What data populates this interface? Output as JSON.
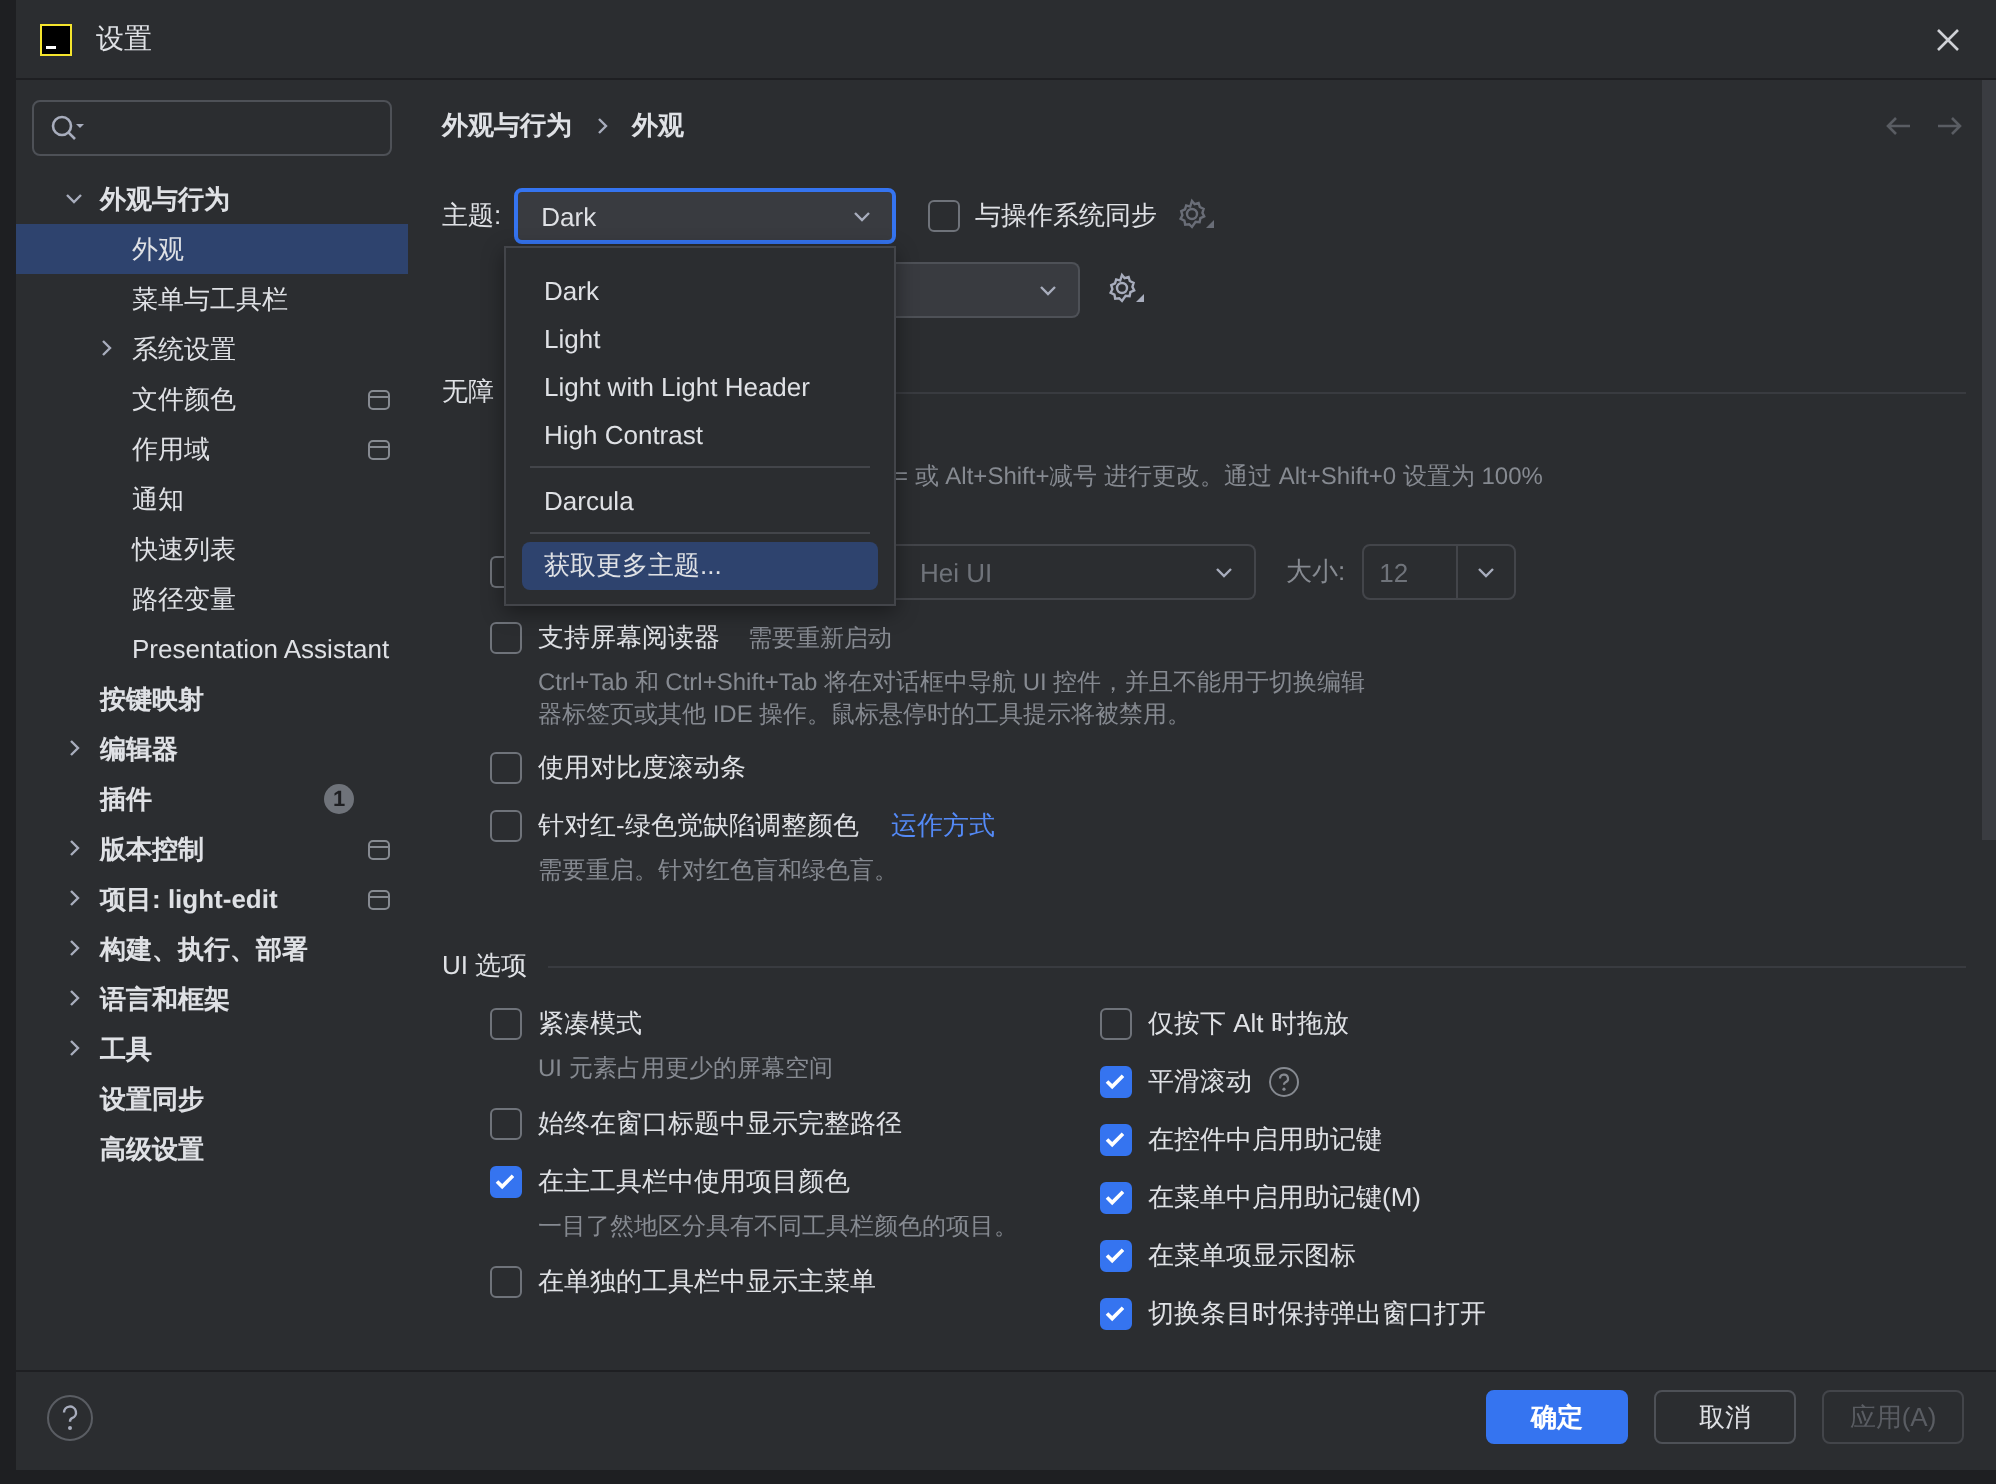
{
  "window": {
    "title": "设置"
  },
  "sidebar": {
    "items": [
      {
        "label": "外观与行为",
        "kind": "group",
        "expanded": true,
        "selected": false,
        "scoped": false,
        "children": [
          {
            "label": "外观",
            "kind": "leaf",
            "selected": true,
            "scoped": false
          },
          {
            "label": "菜单与工具栏",
            "kind": "leaf",
            "selected": false,
            "scoped": false
          },
          {
            "label": "系统设置",
            "kind": "group",
            "expanded": false,
            "selected": false,
            "scoped": false
          },
          {
            "label": "文件颜色",
            "kind": "leaf",
            "selected": false,
            "scoped": true
          },
          {
            "label": "作用域",
            "kind": "leaf",
            "selected": false,
            "scoped": true
          },
          {
            "label": "通知",
            "kind": "leaf",
            "selected": false,
            "scoped": false
          },
          {
            "label": "快速列表",
            "kind": "leaf",
            "selected": false,
            "scoped": false
          },
          {
            "label": "路径变量",
            "kind": "leaf",
            "selected": false,
            "scoped": false
          },
          {
            "label": "Presentation Assistant",
            "kind": "leaf",
            "selected": false,
            "scoped": false
          }
        ]
      },
      {
        "label": "按键映射",
        "kind": "leaf",
        "selected": false,
        "scoped": false
      },
      {
        "label": "编辑器",
        "kind": "group",
        "expanded": false,
        "selected": false,
        "scoped": false
      },
      {
        "label": "插件",
        "kind": "leaf",
        "selected": false,
        "scoped": false,
        "badge": "1"
      },
      {
        "label": "版本控制",
        "kind": "group",
        "expanded": false,
        "selected": false,
        "scoped": true
      },
      {
        "label": "项目: light-edit",
        "kind": "group",
        "expanded": false,
        "selected": false,
        "scoped": true
      },
      {
        "label": "构建、执行、部署",
        "kind": "group",
        "expanded": false,
        "selected": false,
        "scoped": false
      },
      {
        "label": "语言和框架",
        "kind": "group",
        "expanded": false,
        "selected": false,
        "scoped": false
      },
      {
        "label": "工具",
        "kind": "group",
        "expanded": false,
        "selected": false,
        "scoped": false
      },
      {
        "label": "设置同步",
        "kind": "leaf",
        "selected": false,
        "scoped": false
      },
      {
        "label": "高级设置",
        "kind": "leaf",
        "selected": false,
        "scoped": false
      }
    ]
  },
  "content": {
    "breadcrumb": [
      "外观与行为",
      "外观"
    ],
    "theme": {
      "label": "主题:",
      "value": "Dark",
      "menu": [
        {
          "kind": "option",
          "label": "Dark",
          "highlighted": false
        },
        {
          "kind": "option",
          "label": "Light",
          "highlighted": false
        },
        {
          "kind": "option",
          "label": "Light with Light Header",
          "highlighted": false
        },
        {
          "kind": "option",
          "label": "High Contrast",
          "highlighted": false
        },
        {
          "kind": "separator"
        },
        {
          "kind": "option",
          "label": "Darcula",
          "highlighted": false
        },
        {
          "kind": "separator"
        },
        {
          "kind": "option",
          "label": "获取更多主题...",
          "highlighted": true
        }
      ]
    },
    "sync_with_os": {
      "label": "与操作系统同步",
      "checked": false
    },
    "accessibility": {
      "title": "无障",
      "zoom_hint": "= 或 Alt+Shift+减号 进行更改。通过 Alt+Shift+0 设置为 100%",
      "font": {
        "checked": false,
        "value": "Hei UI",
        "size_label": "大小:",
        "size": "12"
      },
      "options": [
        {
          "label": "支持屏幕阅读器",
          "checked": false,
          "note": "需要重新启动",
          "description": "Ctrl+Tab 和 Ctrl+Shift+Tab 将在对话框中导航 UI 控件，并且不能用于切换编辑器标签页或其他 IDE 操作。鼠标悬停时的工具提示将被禁用。"
        },
        {
          "label": "使用对比度滚动条",
          "checked": false
        },
        {
          "label": "针对红-绿色觉缺陷调整颜色",
          "checked": false,
          "link": "运作方式",
          "description": "需要重启。针对红色盲和绿色盲。"
        }
      ]
    },
    "ui_options": {
      "title": "UI 选项",
      "left": [
        {
          "label": "紧凑模式",
          "checked": false,
          "description": "UI 元素占用更少的屏幕空间"
        },
        {
          "label": "始终在窗口标题中显示完整路径",
          "checked": false
        },
        {
          "label": "在主工具栏中使用项目颜色",
          "checked": true,
          "description": "一目了然地区分具有不同工具栏颜色的项目。"
        },
        {
          "label": "在单独的工具栏中显示主菜单",
          "checked": false
        }
      ],
      "right": [
        {
          "label": "仅按下 Alt 时拖放",
          "checked": false
        },
        {
          "label": "平滑滚动",
          "checked": true,
          "help": true
        },
        {
          "label": "在控件中启用助记键",
          "checked": true
        },
        {
          "label": "在菜单中启用助记键(M)",
          "checked": true
        },
        {
          "label": "在菜单项显示图标",
          "checked": true
        },
        {
          "label": "切换条目时保持弹出窗口打开",
          "checked": true
        }
      ]
    }
  },
  "footer": {
    "buttons": [
      {
        "label": "确定",
        "kind": "primary",
        "disabled": false
      },
      {
        "label": "取消",
        "kind": "normal",
        "disabled": false
      },
      {
        "label": "应用(A)",
        "kind": "normal",
        "disabled": true
      }
    ]
  }
}
